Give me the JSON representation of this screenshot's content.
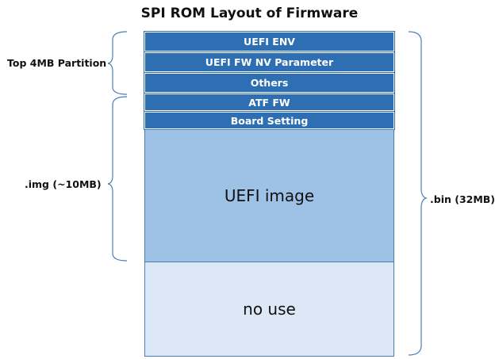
{
  "title": "SPI ROM Layout of Firmware",
  "blocks": [
    {
      "label": "UEFI ENV",
      "style": "dark"
    },
    {
      "label": "UEFI FW NV Parameter",
      "style": "dark"
    },
    {
      "label": "Others",
      "style": "dark"
    },
    {
      "label": "ATF FW",
      "style": "dark"
    },
    {
      "label": "Board Setting",
      "style": "dark"
    },
    {
      "label": "UEFI image",
      "style": "mid"
    },
    {
      "label": "no use",
      "style": "light"
    }
  ],
  "braces": {
    "top_partition": "Top 4MB Partition",
    "img": ".img (~10MB)",
    "bin": ".bin (32MB)"
  },
  "colors": {
    "dark_block": "#2e6fb4",
    "uefi_image": "#9ec2e6",
    "no_use": "#dce8f5",
    "brace": "#4a7fb7"
  }
}
